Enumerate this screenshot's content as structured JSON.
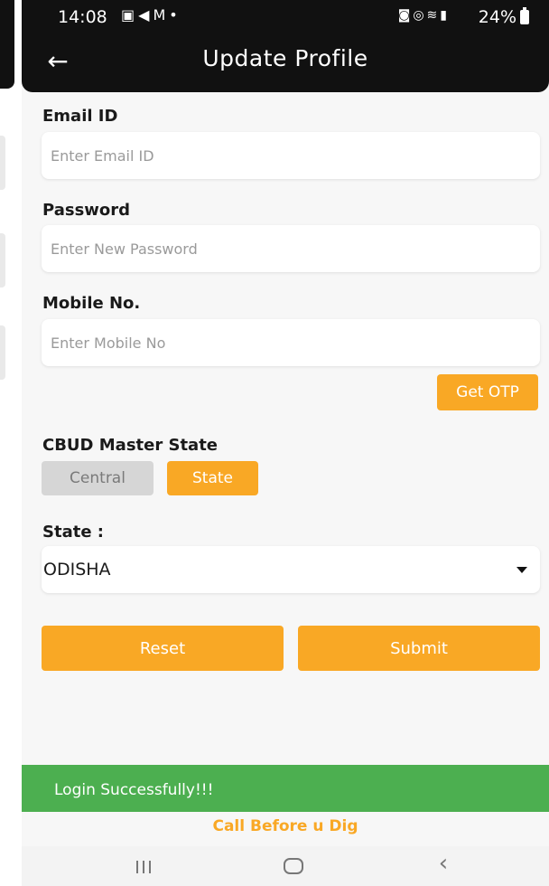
{
  "status_bar": {
    "time": "14:08",
    "battery": "24%"
  },
  "header": {
    "title": "Update Profile"
  },
  "form": {
    "email": {
      "label": "Email ID",
      "placeholder": "Enter Email ID",
      "value": ""
    },
    "password": {
      "label": "Password",
      "placeholder": "Enter New Password",
      "value": ""
    },
    "mobile": {
      "label": "Mobile No.",
      "placeholder": "Enter Mobile No",
      "value": ""
    },
    "otp_button": "Get OTP",
    "master_state": {
      "label": "CBUD Master State",
      "options": [
        "Central",
        "State"
      ],
      "selected": "State"
    },
    "state": {
      "label": "State :",
      "value": "ODISHA"
    },
    "reset_button": "Reset",
    "submit_button": "Submit"
  },
  "toast": {
    "message": "Login Successfully!!!"
  },
  "footer": {
    "text": "Call Before u Dig"
  },
  "colors": {
    "accent": "#f9a825",
    "header_bg": "#111111",
    "toast_bg": "#4caf50",
    "inactive_toggle": "#d6d6d6"
  },
  "icons": {
    "back": "arrow-left-icon",
    "dropdown": "caret-down-icon",
    "nav_recents": "recents-icon",
    "nav_home": "home-icon",
    "nav_back": "back-chevron-icon"
  }
}
